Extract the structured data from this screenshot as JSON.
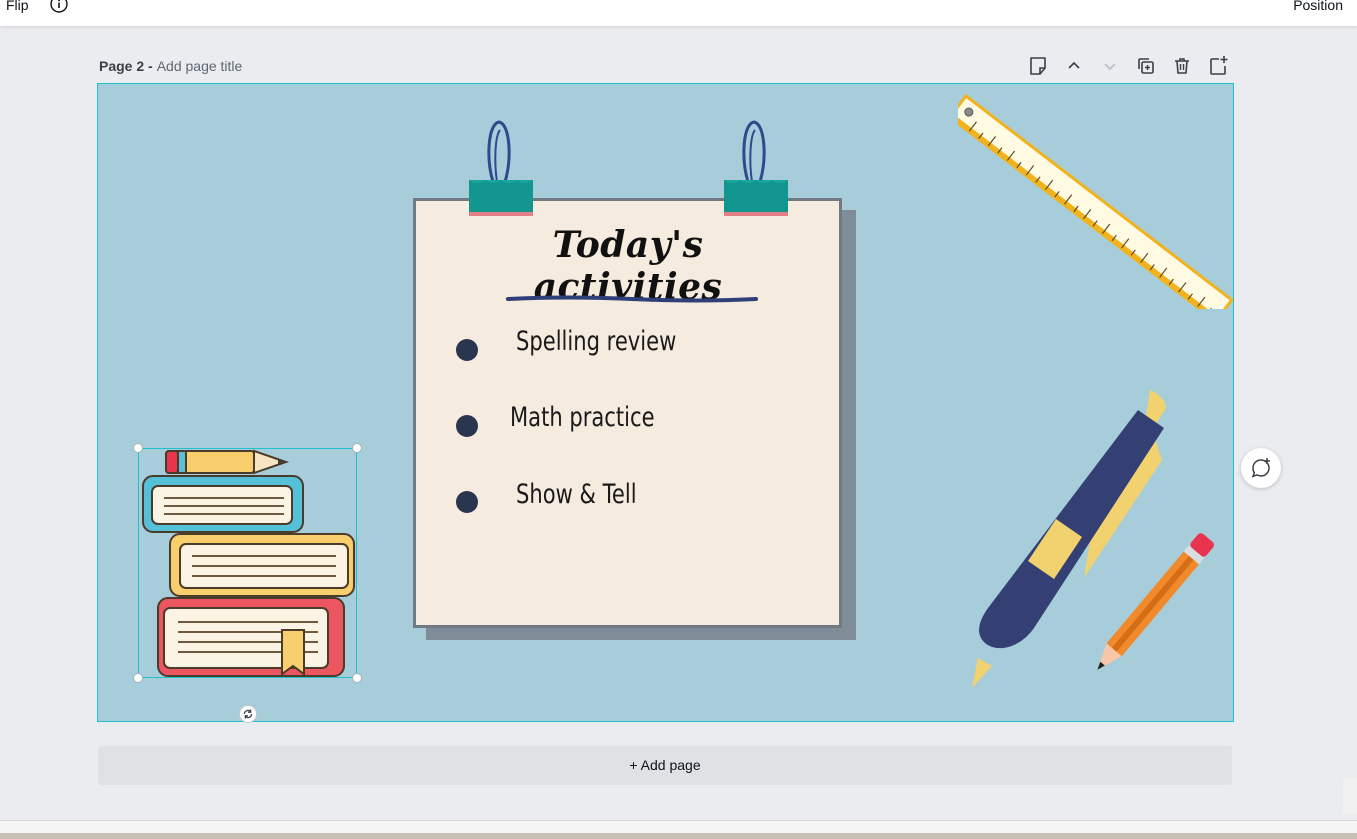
{
  "toolbar": {
    "flip_label": "Flip",
    "info_icon": "info-icon",
    "position_label": "Position"
  },
  "page": {
    "number_label": "Page 2 -",
    "title_placeholder": "Add page title"
  },
  "page_tools": [
    "notes-icon",
    "move-up-icon",
    "move-down-icon",
    "duplicate-page-icon",
    "delete-page-icon",
    "add-page-icon"
  ],
  "design": {
    "headline": "Today's activities",
    "activities": [
      "Spelling review",
      "Math practice",
      "Show & Tell"
    ]
  },
  "add_page_label": "+ Add page",
  "colors": {
    "canvas_bg": "#a7cddb",
    "selection": "#1fc1cf",
    "paper": "#f5ebdf",
    "bullet": "#2a3550"
  }
}
